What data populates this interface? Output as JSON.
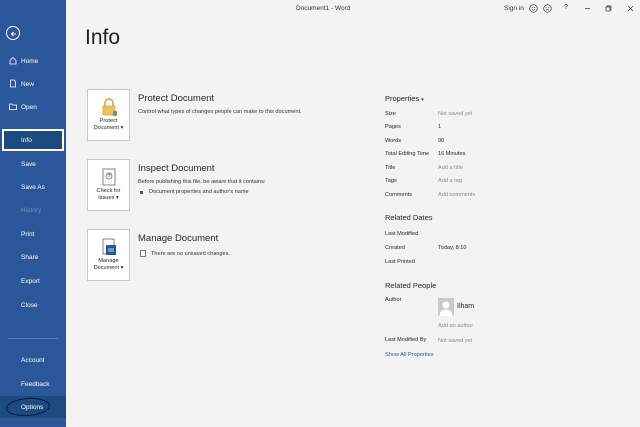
{
  "window": {
    "title": "Document1 - Word",
    "sign_in": "Sign in",
    "help": "?"
  },
  "sidebar": {
    "items": [
      {
        "label": "Home",
        "icon": "home-icon"
      },
      {
        "label": "New",
        "icon": "new-document-icon"
      },
      {
        "label": "Open",
        "icon": "folder-open-icon"
      },
      {
        "label": "Info"
      },
      {
        "label": "Save"
      },
      {
        "label": "Save As"
      },
      {
        "label": "History"
      },
      {
        "label": "Print"
      },
      {
        "label": "Share"
      },
      {
        "label": "Export"
      },
      {
        "label": "Close"
      },
      {
        "label": "Account"
      },
      {
        "label": "Feedback"
      },
      {
        "label": "Options"
      }
    ],
    "active": "Info"
  },
  "main": {
    "heading": "Info",
    "sections": [
      {
        "button_label_1": "Protect",
        "button_label_2": "Document",
        "title": "Protect Document",
        "desc": "Control what types of changes people can make to this document."
      },
      {
        "button_label_1": "Check for",
        "button_label_2": "Issues",
        "title": "Inspect Document",
        "desc": "Before publishing this file, be aware that it contains:",
        "bullet": "Document properties and author's name"
      },
      {
        "button_label_1": "Manage",
        "button_label_2": "Document",
        "title": "Manage Document",
        "bullet": "There are no unsaved changes."
      }
    ]
  },
  "properties": {
    "heading": "Properties",
    "rows": [
      {
        "label": "Size",
        "value": "Not saved yet"
      },
      {
        "label": "Pages",
        "value": "1"
      },
      {
        "label": "Words",
        "value": "90"
      },
      {
        "label": "Total Editing Time",
        "value": "16 Minutes"
      },
      {
        "label": "Title",
        "value": "Add a title"
      },
      {
        "label": "Tags",
        "value": "Add a tag"
      },
      {
        "label": "Comments",
        "value": "Add comments"
      }
    ],
    "related_dates": {
      "heading": "Related Dates",
      "rows": [
        {
          "label": "Last Modified",
          "value": ""
        },
        {
          "label": "Created",
          "value": "Today, 8:10"
        },
        {
          "label": "Last Printed",
          "value": ""
        }
      ]
    },
    "related_people": {
      "heading": "Related People",
      "author_label": "Author",
      "author_name": "Ilham",
      "add_author": "Add an author",
      "last_modified_by_label": "Last Modified By",
      "last_modified_by_value": "Not saved yet"
    },
    "show_all": "Show All Properties"
  },
  "colors": {
    "sidebar": "#2b579a",
    "sidebar_active": "#1e4a82",
    "background": "#f3f3f3",
    "link": "#2b579a"
  }
}
